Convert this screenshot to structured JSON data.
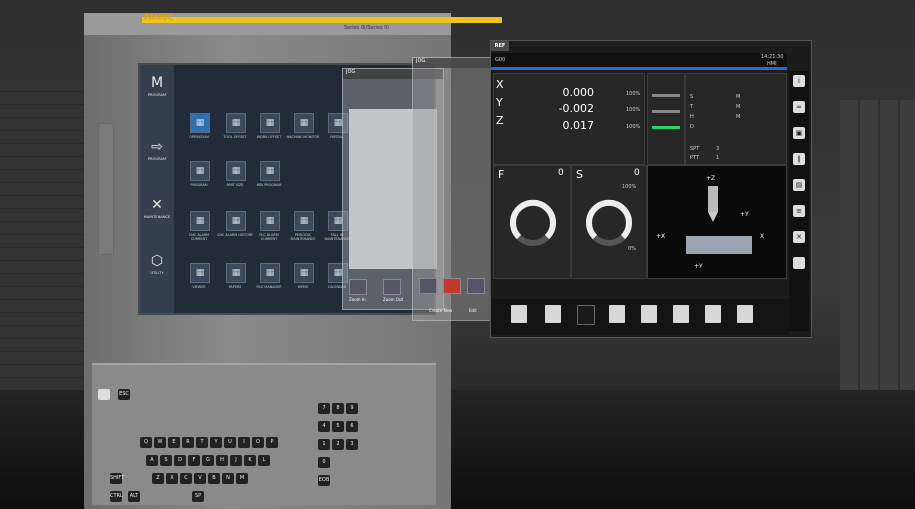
{
  "machine": {
    "brand": "FANUC",
    "series": "Series 0i/Series 0i",
    "sidebar": [
      {
        "label": "PROGRAM",
        "glyph": "M"
      },
      {
        "label": "PROGRAM",
        "glyph": "⇨"
      },
      {
        "label": "MAINTENANCE",
        "glyph": "✕"
      },
      {
        "label": "UTILITY",
        "glyph": "⬡"
      }
    ],
    "tiles": [
      "OPERATION",
      "TOOL OFFSET",
      "WORK OFFSET",
      "MACHINE MONITOR",
      "PARTIAL",
      "PROGRAM",
      "PART SIZE",
      "MDI PROGRAM",
      "CNC ALARM CURRENT",
      "CNC ALARM HISTORY",
      "PLC ALARM CURRENT",
      "PERIODIC MAINTENANCE",
      "FALL IN MAINTENANCE",
      "VIEWER",
      "PAPERS",
      "FILE MANAGER",
      "MEMO",
      "CALENDAR"
    ],
    "keys": [
      "ESC",
      "Q",
      "W",
      "E",
      "R",
      "T",
      "Y",
      "U",
      "I",
      "O",
      "P",
      "A",
      "S",
      "D",
      "F",
      "G",
      "H",
      "J",
      "K",
      "L",
      "Z",
      "X",
      "C",
      "V",
      "B",
      "N",
      "M",
      "SHIFT",
      "CTRL",
      "ALT",
      "SP",
      "7",
      "8",
      "9",
      "4",
      "5",
      "6",
      "1",
      "2",
      "3",
      "0",
      "EOB"
    ]
  },
  "jog": {
    "title": "JOG",
    "title2": "JOG",
    "create_new": "Create New",
    "edit": "Edit",
    "zoom_in": "Zoom In",
    "zoom_out": "Zoom Out"
  },
  "ref": {
    "tab": "REF",
    "program": "G00",
    "time": "14:21:30",
    "mode": "HMI",
    "axes": [
      {
        "name": "X",
        "value": "0.000",
        "pct": "100%"
      },
      {
        "name": "Y",
        "value": "-0.002",
        "pct": "100%"
      },
      {
        "name": "Z",
        "value": "0.017",
        "pct": "100%"
      }
    ],
    "spindle": {
      "feed": "F",
      "feed_val": "0",
      "s": "S",
      "s_val": "0",
      "pct1": "100%",
      "pct2": "0%"
    },
    "status": [
      {
        "key": "S",
        "val": "M"
      },
      {
        "key": "T",
        "val": "M"
      },
      {
        "key": "H",
        "val": "M"
      },
      {
        "key": "D",
        "val": ""
      }
    ],
    "spt": {
      "label": "SPT",
      "val": "3"
    },
    "ptt": {
      "label": "PTT",
      "val": "1"
    }
  }
}
